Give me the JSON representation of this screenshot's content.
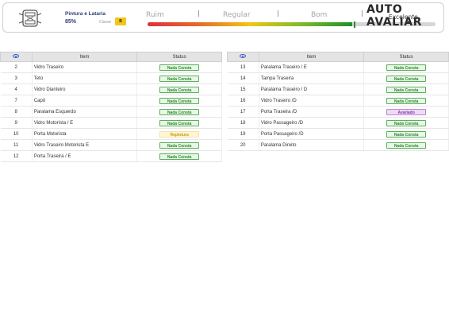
{
  "header": {
    "section_title": "Pintura e Lataria",
    "section_percent": "85%",
    "class_label": "Classe",
    "class_value": "B",
    "scale_labels": [
      "Ruim",
      "Regular",
      "Bom"
    ],
    "scale_value_percent": 71,
    "brand": "AUTO AVALIAR",
    "rating": "Excelente"
  },
  "tables": [
    {
      "headers": [
        "",
        "Item",
        "Status"
      ],
      "rows": [
        {
          "num": "2",
          "item": "Vidro Traseiro",
          "status": "Nada Consta",
          "kind": "ok"
        },
        {
          "num": "3",
          "item": "Teto",
          "status": "Nada Consta",
          "kind": "ok"
        },
        {
          "num": "4",
          "item": "Vidro Dianteiro",
          "status": "Nada Consta",
          "kind": "ok"
        },
        {
          "num": "7",
          "item": "Capô",
          "status": "Nada Consta",
          "kind": "ok"
        },
        {
          "num": "8",
          "item": "Paralama Esquerdo",
          "status": "Nada Consta",
          "kind": "ok"
        },
        {
          "num": "9",
          "item": "Vidro Motorista / E",
          "status": "Nada Consta",
          "kind": "ok"
        },
        {
          "num": "10",
          "item": "Porta Motorista",
          "status": "Repintura",
          "kind": "rep"
        },
        {
          "num": "11",
          "item": "Vidro Traseiro Motorista E",
          "status": "Nada Consta",
          "kind": "ok"
        },
        {
          "num": "12",
          "item": "Porta Traseira / E",
          "status": "Nada Consta",
          "kind": "ok"
        }
      ]
    },
    {
      "headers": [
        "",
        "Item",
        "Status"
      ],
      "rows": [
        {
          "num": "13",
          "item": "Paralama Traseiro / E",
          "status": "Nada Consta",
          "kind": "ok"
        },
        {
          "num": "14",
          "item": "Tampa Traseira",
          "status": "Nada Consta",
          "kind": "ok"
        },
        {
          "num": "15",
          "item": "Paralama Traseiro / D",
          "status": "Nada Consta",
          "kind": "ok"
        },
        {
          "num": "16",
          "item": "Vidro Traseiro /D",
          "status": "Nada Consta",
          "kind": "ok"
        },
        {
          "num": "17",
          "item": "Porta Traseira /D",
          "status": "Avariado",
          "kind": "av"
        },
        {
          "num": "18",
          "item": "Vidro Passageiro /D",
          "status": "Nada Consta",
          "kind": "ok"
        },
        {
          "num": "19",
          "item": "Porta Passageiro /D",
          "status": "Nada Consta",
          "kind": "ok"
        },
        {
          "num": "20",
          "item": "Paralama Direito",
          "status": "Nada Consta",
          "kind": "ok"
        }
      ]
    }
  ]
}
